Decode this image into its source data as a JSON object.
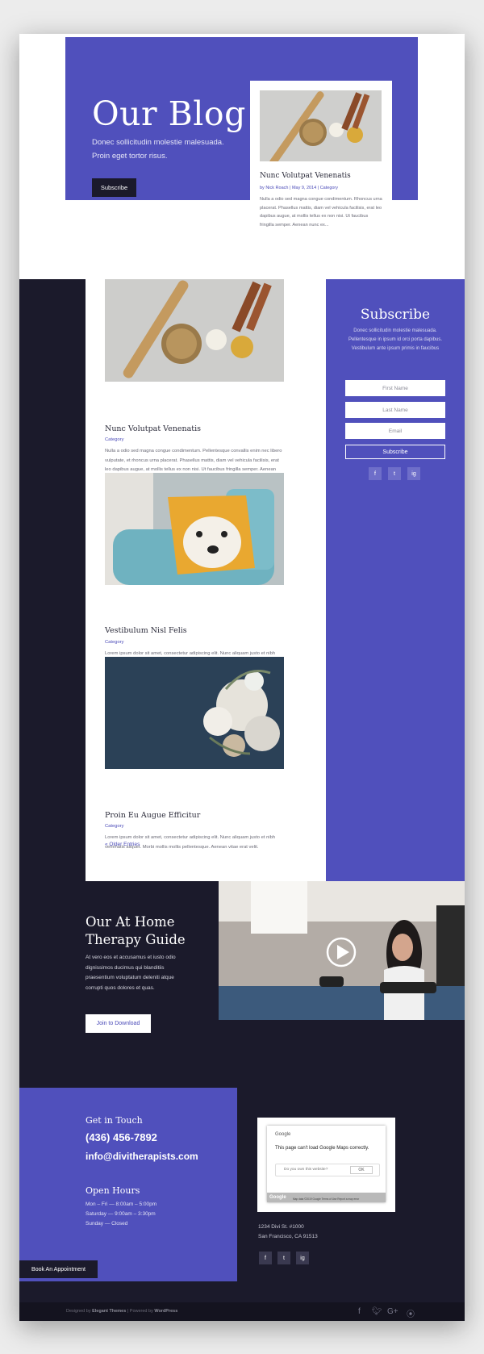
{
  "colors": {
    "purple": "#5050bc",
    "dark": "#1b1a2b",
    "accent_text": "#4b4bb8"
  },
  "hero": {
    "title": "Our Blog",
    "subtitle": "Donec sollicitudin molestie malesuada. Proin eget tortor risus.",
    "button": "Subscribe"
  },
  "featured": {
    "title": "Nunc Volutpat Venenatis",
    "meta": "by Nick Roach | May 9, 2014 | Category",
    "excerpt": "Nulla a odio sed magna congue condimentum. Rhoncus urna placerat. Phasellus mattis, diam vel vehicula facilisis, erat leo dapibus augue, at mollis tellus ex non nisi. Ut faucibus fringilla semper. Aenean nunc ex..."
  },
  "posts": [
    {
      "title": "Nunc Volutpat Venenatis",
      "category": "Category",
      "excerpt": "Nulla a odio sed magna congue condimentum. Pellentesque convallis enim nec libero vulputate, et rhoncus urna placerat. Phasellus mattis, diam vel vehicula facilisis, erat leo dapibus augue, at mollis tellus ex non nisi. Ut faucibus fringilla semper. Aenean nunc ex..."
    },
    {
      "title": "Vestibulum Nisl Felis",
      "category": "Category",
      "excerpt": "Lorem ipsum dolor sit amet, consectetur adipiscing elit. Nunc aliquam justo et nibh venenatis aliquet. Morbi mollis mollis pellentesque. Aenean vitae erat velit."
    },
    {
      "title": "Proin Eu Augue Efficitur",
      "category": "Category",
      "excerpt": "Lorem ipsum dolor sit amet, consectetur adipiscing elit. Nunc aliquam justo et nibh venenatis aliquet. Morbi mollis mollis pellentesque. Aenean vitae erat velit."
    }
  ],
  "older_entries": "« Older Entries",
  "subscribe": {
    "title": "Subscribe",
    "text": "Donec sollicitudin molestie malesuada. Pellentesque in ipsum id orci porta dapibus. Vestibulum ante ipsum primis in faucibus",
    "first_name": "First Name",
    "last_name": "Last Name",
    "email": "Email",
    "button": "Subscribe",
    "social": [
      "f",
      "t",
      "ig"
    ]
  },
  "guide": {
    "title": "Our At Home Therapy Guide",
    "text": "At vero eos et accusamus et iusto odio dignissimos ducimus qui blanditiis praesentium voluptatum deleniti atque corrupti quos dolores et quas.",
    "button": "Join to Download"
  },
  "contact": {
    "heading": "Get in Touch",
    "phone": "(436) 456-7892",
    "email": "info@divitherapists.com",
    "hours_heading": "Open Hours",
    "hours": [
      "Mon – Fri — 8:00am – 5:00pm",
      "Saturday — 9:00am – 3:30pm",
      "Sunday — Closed"
    ]
  },
  "map": {
    "brand": "Google",
    "error": "This page can't load Google Maps correctly.",
    "question": "Do you own this website?",
    "ok": "OK",
    "footer_brand": "Google",
    "footer_links": "Map data ©2019 Google  Terms of Use  Report a map error"
  },
  "address": {
    "line1": "1234 Divi St. #1000",
    "line2": "San Francisco, CA 91513"
  },
  "book_button": "Book An Appointment",
  "credit": {
    "designed_by": "Designed by ",
    "elegant": "Elegant Themes",
    "powered": " | Powered by ",
    "wordpress": "WordPress"
  }
}
